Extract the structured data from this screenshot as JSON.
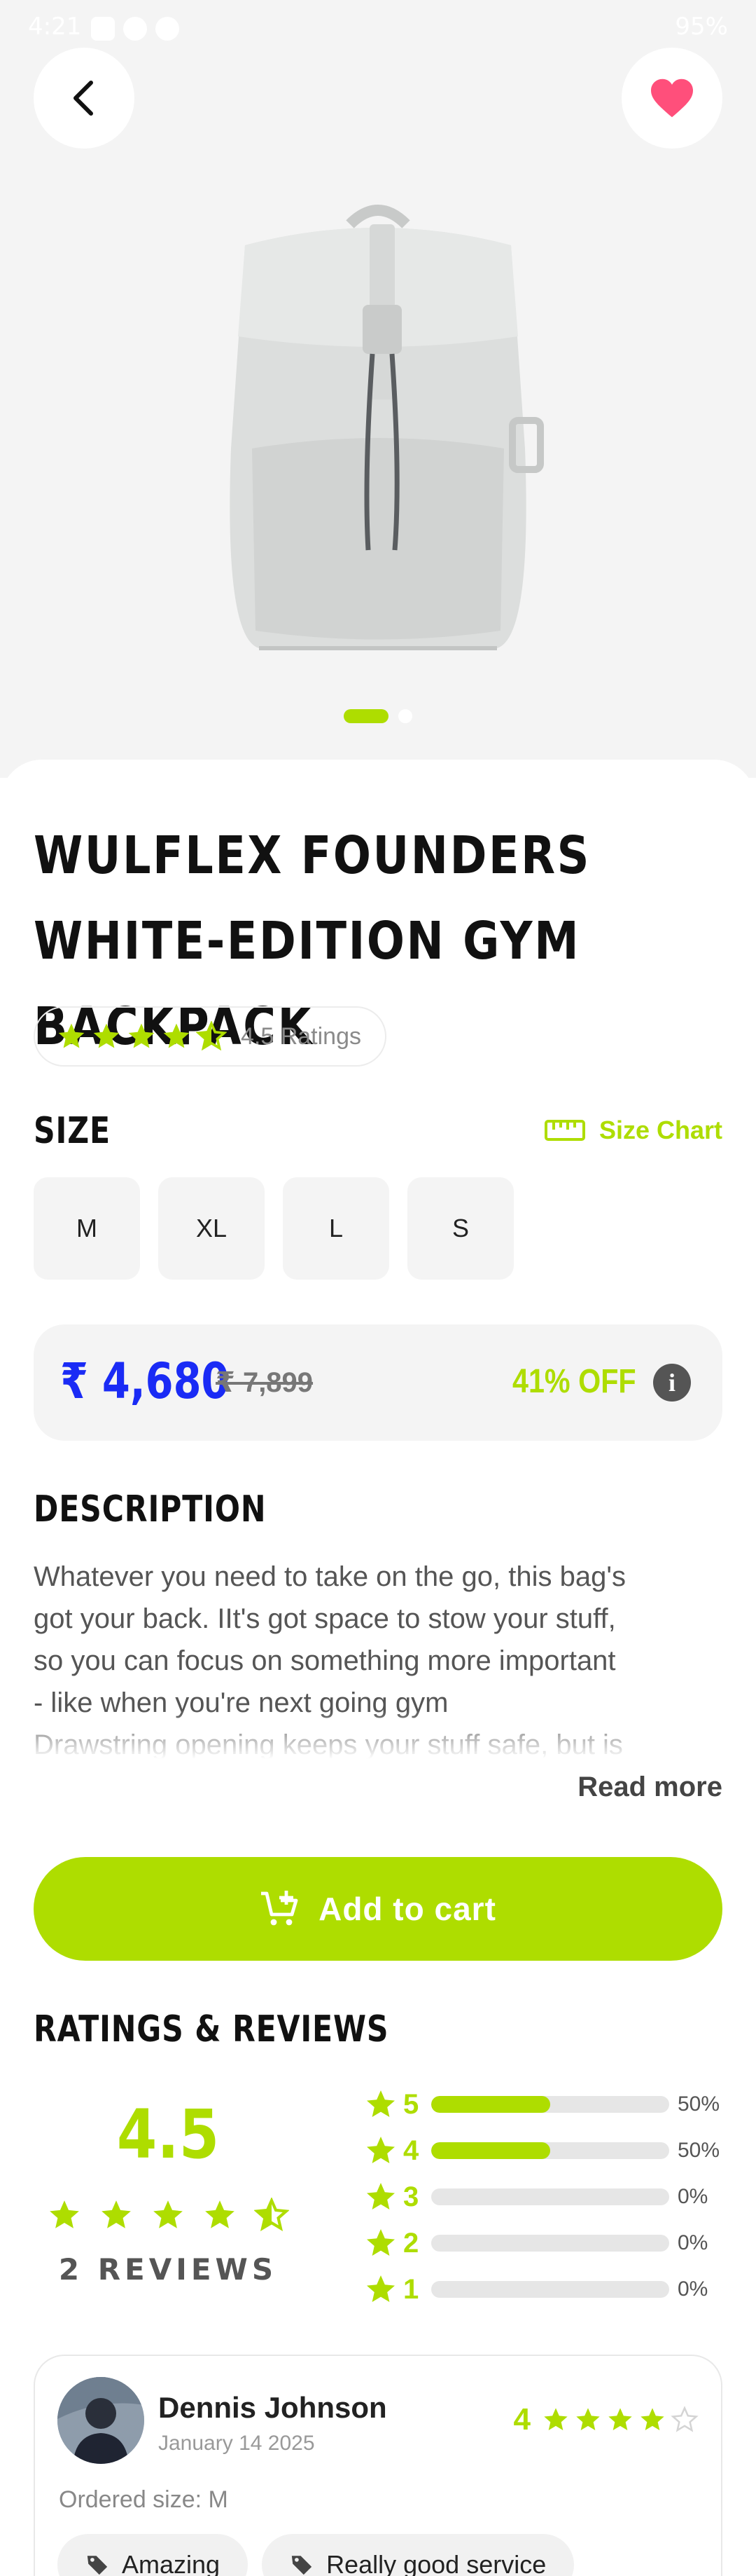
{
  "status_bar": {
    "time": "4:21",
    "battery": "95%"
  },
  "product": {
    "title": "WULFLEX FOUNDERS WHITE-EDITION GYM BACKPACK",
    "rating_text": "4.5 Ratings",
    "rating_value": 4.5,
    "carousel": {
      "total": 2,
      "active": 1
    }
  },
  "size": {
    "heading": "SIZE",
    "chart_label": "Size Chart",
    "options": [
      "M",
      "XL",
      "L",
      "S"
    ]
  },
  "price": {
    "current": "₹ 4,680",
    "original": "₹ 7,899",
    "discount": "41% OFF"
  },
  "description": {
    "heading": "DESCRIPTION",
    "text": "Whatever you need to take on the go, this bag's\ngot your back. IIt's got space to stow your stuff,\nso you can focus on something more important\n- like when you're next going gym\nDrawstring opening keeps your stuff safe, but is",
    "read_more": "Read more"
  },
  "cart": {
    "label": "Add to cart"
  },
  "reviews": {
    "heading": "RATINGS & REVIEWS",
    "average": "4.5",
    "average_value": 4.5,
    "count_label": "2 REVIEWS",
    "breakdown": [
      {
        "star": "5",
        "percent": "50%",
        "fraction": 0.5
      },
      {
        "star": "4",
        "percent": "50%",
        "fraction": 0.5
      },
      {
        "star": "3",
        "percent": "0%",
        "fraction": 0
      },
      {
        "star": "2",
        "percent": "0%",
        "fraction": 0
      },
      {
        "star": "1",
        "percent": "0%",
        "fraction": 0
      }
    ],
    "items": [
      {
        "name": "Dennis Johnson",
        "date": "January 14 2025",
        "score": "4",
        "score_value": 4,
        "ordered_size": "Ordered size: M",
        "tags": [
          "Amazing",
          "Really good service"
        ]
      }
    ]
  },
  "colors": {
    "accent": "#aedd00",
    "price": "#1a2bf5",
    "favorite": "#ff4f7b"
  },
  "icons": [
    "back-arrow-icon",
    "heart-icon",
    "ruler-icon",
    "info-icon",
    "cart-plus-icon",
    "star-icon",
    "tag-icon"
  ]
}
